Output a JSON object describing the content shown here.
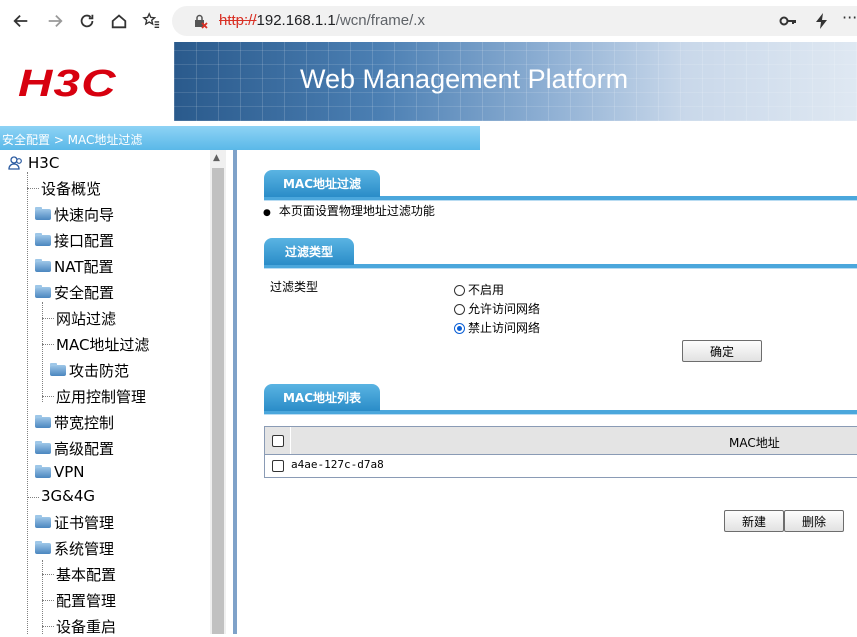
{
  "browser": {
    "url_scheme": "http://",
    "url_host": "192.168.1.1",
    "url_path": "/wcn/frame/.x"
  },
  "banner": {
    "logo": "H3C",
    "title": "Web Management Platform"
  },
  "breadcrumb": "安全配置 > MAC地址过滤",
  "sidebar": {
    "root": "H3C",
    "items": [
      {
        "label": "设备概览"
      },
      {
        "label": "快速向导"
      },
      {
        "label": "接口配置"
      },
      {
        "label": "NAT配置"
      },
      {
        "label": "安全配置"
      },
      {
        "label": "网站过滤"
      },
      {
        "label": "MAC地址过滤"
      },
      {
        "label": "攻击防范"
      },
      {
        "label": "应用控制管理"
      },
      {
        "label": "带宽控制"
      },
      {
        "label": "高级配置"
      },
      {
        "label": "VPN"
      },
      {
        "label": "3G&4G"
      },
      {
        "label": "证书管理"
      },
      {
        "label": "系统管理"
      },
      {
        "label": "基本配置"
      },
      {
        "label": "配置管理"
      },
      {
        "label": "设备重启"
      }
    ]
  },
  "main": {
    "section1": {
      "title": "MAC地址过滤",
      "description": "本页面设置物理地址过滤功能"
    },
    "section2": {
      "title": "过滤类型",
      "field_label": "过滤类型",
      "options": [
        "不启用",
        "允许访问网络",
        "禁止访问网络"
      ],
      "selected": "禁止访问网络",
      "confirm_button": "确定"
    },
    "section3": {
      "title": "MAC地址列表",
      "column_header": "MAC地址",
      "rows": [
        "a4ae-127c-d7a8"
      ],
      "new_button": "新建",
      "delete_button": "删除"
    }
  }
}
